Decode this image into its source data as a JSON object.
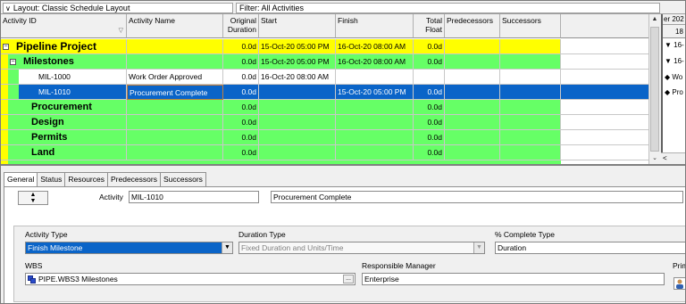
{
  "topbar": {
    "layout_label": "Layout: Classic Schedule Layout",
    "filter_label": "Filter: All Activities"
  },
  "columns": {
    "activity_id": "Activity ID",
    "activity_name": "Activity Name",
    "original_duration": "Original Duration",
    "start": "Start",
    "finish": "Finish",
    "total_float": "Total Float",
    "predecessors": "Predecessors",
    "successors": "Successors"
  },
  "rows": [
    {
      "id": "Pipeline Project",
      "name": "",
      "dur": "0.0d",
      "start": "15-Oct-20 05:00 PM",
      "finish": "16-Oct-20 08:00 AM",
      "float": "0.0d"
    },
    {
      "id": "Milestones",
      "name": "",
      "dur": "0.0d",
      "start": "15-Oct-20 05:00 PM",
      "finish": "16-Oct-20 08:00 AM",
      "float": "0.0d"
    },
    {
      "id": "MIL-1000",
      "name": "Work Order Approved",
      "dur": "0.0d",
      "start": "16-Oct-20 08:00 AM",
      "finish": "",
      "float": ""
    },
    {
      "id": "MIL-1010",
      "name": "Procurement Complete",
      "dur": "0.0d",
      "start": "",
      "finish": "15-Oct-20 05:00 PM",
      "float": "0.0d"
    },
    {
      "id": "Procurement",
      "name": "",
      "dur": "0.0d",
      "start": "",
      "finish": "",
      "float": "0.0d"
    },
    {
      "id": "Design",
      "name": "",
      "dur": "0.0d",
      "start": "",
      "finish": "",
      "float": "0.0d"
    },
    {
      "id": "Permits",
      "name": "",
      "dur": "0.0d",
      "start": "",
      "finish": "",
      "float": "0.0d"
    },
    {
      "id": "Land",
      "name": "",
      "dur": "0.0d",
      "start": "",
      "finish": "",
      "float": "0.0d"
    }
  ],
  "gantt": {
    "header1": "er 202",
    "header2": "18",
    "items": [
      "16-",
      "16-",
      "Wo",
      "Pro"
    ]
  },
  "details": {
    "tabs": [
      "General",
      "Status",
      "Resources",
      "Predecessors",
      "Successors"
    ],
    "activity_label": "Activity",
    "activity_id": "MIL-1010",
    "activity_name": "Procurement Complete",
    "activity_type_label": "Activity Type",
    "activity_type_value": "Finish Milestone",
    "duration_type_label": "Duration Type",
    "duration_type_value": "Fixed Duration and Units/Time",
    "pct_complete_label": "% Complete Type",
    "pct_complete_value": "Duration",
    "wbs_label": "WBS",
    "wbs_value": "PIPE.WBS3  Milestones",
    "resp_manager_label": "Responsible Manager",
    "resp_manager_value": "Enterprise",
    "primary_label": "Prim"
  },
  "colors": {
    "project_row": "#ffff00",
    "wbs_row": "#66ff66",
    "selected": "#0a64c8"
  }
}
